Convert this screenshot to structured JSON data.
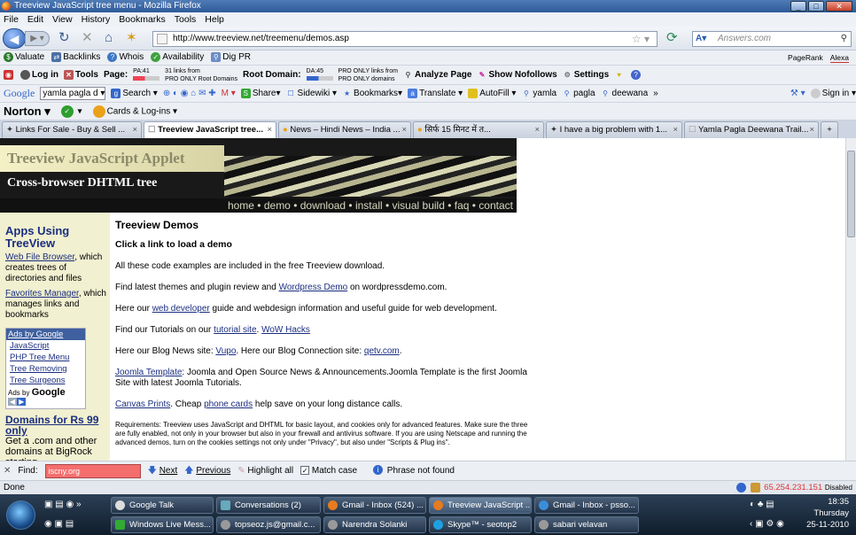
{
  "window": {
    "title": "Treeview JavaScript tree menu - Mozilla Firefox"
  },
  "menubar": [
    "File",
    "Edit",
    "View",
    "History",
    "Bookmarks",
    "Tools",
    "Help"
  ],
  "nav": {
    "url": "http://www.treeview.net/treemenu/demos.asp",
    "search_placeholder": "Answers.com"
  },
  "toolbar1": {
    "items": [
      "Valuate",
      "Backlinks",
      "Whois",
      "Availability",
      "Dig PR"
    ],
    "pagerank": "PageRank",
    "alexa": "Alexa"
  },
  "toolbar2": {
    "login": "Log in",
    "tools": "Tools",
    "page": "Page:",
    "pa": "PA:41",
    "links_from": "31 links from",
    "pro_only_root": "PRO ONLY Root Domains",
    "root_domain": "Root Domain:",
    "da": "DA:45",
    "pro_only_links": "PRO ONLY links from",
    "pro_only_domains": "PRO ONLY domains",
    "analyze": "Analyze Page",
    "nofollows": "Show Nofollows",
    "settings": "Settings"
  },
  "toolbar3": {
    "google": "Google",
    "query": "yamla pagla d",
    "search": "Search",
    "share": "Share",
    "sidewiki": "Sidewiki",
    "bookmarks": "Bookmarks",
    "translate": "Translate",
    "autofill": "AutoFill",
    "w1": "yamla",
    "w2": "pagla",
    "w3": "deewana",
    "more": "»",
    "signin": "Sign in"
  },
  "toolbar4": {
    "norton": "Norton",
    "cards": "Cards & Log-ins"
  },
  "tabs": [
    {
      "label": "Links For Sale - Buy & Sell ..."
    },
    {
      "label": "Treeview JavaScript tree..."
    },
    {
      "label": "News – Hindi News – India ..."
    },
    {
      "label": "सिर्फ 15 मिनट में त..."
    },
    {
      "label": "I have a big problem with 1..."
    },
    {
      "label": "Yamla Pagla Deewana Trail..."
    }
  ],
  "banner": {
    "title": "Treeview JavaScript Applet",
    "subtitle": "Cross-browser DHTML tree",
    "nav": "home • demo • download • install • visual build • faq • contact"
  },
  "sidebar": {
    "heading": "Apps Using TreeView",
    "link1": "Web File Browser",
    "text1": ", which creates trees of directories and files",
    "link2": "Favorites Manager",
    "text2": ", which manages links and bookmarks",
    "ads_header": "Ads by Google",
    "ads": [
      "JavaScript",
      "PHP Tree Menu",
      "Tree Removing",
      "Tree Surgeons"
    ],
    "ads_footer_pre": "Ads by",
    "ads_footer_brand": "Google",
    "domains_title": "Domains for Rs 99 only",
    "domains_text": "Get a .com and other domains at BigRock starting"
  },
  "main": {
    "heading": "Treeview Demos",
    "subheading": "Click a link to load a demo",
    "p1": "All these code examples are included in the free Treeview download.",
    "p2_pre": "Find latest themes and plugin review and ",
    "p2_link": "Wordpress Demo",
    "p2_post": " on wordpressdemo.com.",
    "p3_pre": "Here our ",
    "p3_link": "web developer",
    "p3_post": " guide and webdesign information and useful guide for web development.",
    "p4_pre": "Find our Tutorials on our ",
    "p4_link1": "tutorial site",
    "p4_mid": ". ",
    "p4_link2": "WoW Hacks",
    "p5_pre": "Here our Blog News site: ",
    "p5_link1": "Vupo",
    "p5_mid": ". Here our Blog Connection site: ",
    "p5_link2": "qetv.com",
    "p5_post": ".",
    "p6_link": "Joomla Template",
    "p6_post": ": Joomla and Open Source News & Announcements.Joomla Template is the first Joomla Site with latest Joomla Tutorials.",
    "p7_link1": "Canvas Prints",
    "p7_mid": ". Cheap ",
    "p7_link2": "phone cards",
    "p7_post": " help save on your long distance calls.",
    "p8": "Requirements: Treeview uses JavaScript and DHTML for basic layout, and cookies only for advanced features. Make sure the three are fully enabled, not only in your browser but also in your firewall and antivirus software. If you are using Netscape and running the advanced demos, turn on the cookies settings not only under \"Privacy\", but also under \"Scripts & Plug ins\"."
  },
  "findbar": {
    "label": "Find:",
    "value": "iscny.org",
    "next": "Next",
    "previous": "Previous",
    "highlight": "Highlight all",
    "matchcase": "Match case",
    "status": "Phrase not found"
  },
  "status": {
    "text": "Done",
    "ip": "65.254.231.151",
    "disabled": "Disabled"
  },
  "taskbar": {
    "row1": [
      "Google Talk",
      "Conversations (2)",
      "Gmail - Inbox (524) ...",
      "Treeview JavaScript ...",
      "Gmail - Inbox - psso..."
    ],
    "row2": [
      "Windows Live Mess...",
      "topseoz.js@gmail.c...",
      "Narendra Solanki",
      "Skype™ - seotop2",
      "sabari velavan"
    ],
    "time": "18:35",
    "day": "Thursday",
    "date": "25-11-2010"
  }
}
